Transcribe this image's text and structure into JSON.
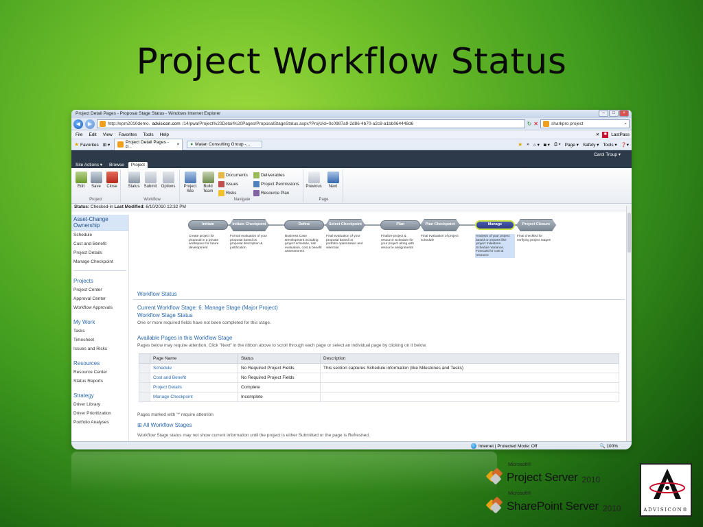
{
  "slide": {
    "title": "Project Workflow Status"
  },
  "browser": {
    "window_title": "Project Detail Pages - Proposal Stage Status - Windows Internet Explorer",
    "url_prefix": "http://epm2010demo.",
    "url_host": "advisicon.com",
    "url_path": "/14/pwa/Project%20Detail%20Pages/ProposalStageStatus.aspx?ProjUid=0c0987a9-2d86-4b70-a2c8-a1bb064448d6",
    "search_value": "sharkpro project",
    "menu": [
      "File",
      "Edit",
      "View",
      "Favorites",
      "Tools",
      "Help"
    ],
    "lastpass_label": "LastPass",
    "favorites_label": "Favorites",
    "tabs": [
      {
        "label": "Project Detail Pages - P..."
      },
      {
        "label": "Matan Consulting Group -..."
      }
    ],
    "cmd_tools": [
      "Page ▾",
      "Safety ▾",
      "Tools ▾"
    ],
    "status_zone": "Internet | Protected Mode: Off",
    "zoom": "100%"
  },
  "sharepoint": {
    "user": "Carol Troup ▾",
    "ribbon_tabs": [
      "Site Actions ▾",
      "Browse",
      "Project"
    ],
    "ribbon": {
      "project_group": "Project",
      "workflow_group": "Workflow",
      "navigate_group": "Navigate",
      "page_group": "Page",
      "edit": "Edit",
      "save": "Save",
      "close": "Close",
      "status": "Status",
      "submit": "Submit",
      "options": "Options",
      "project_site": "Project Site",
      "build_team": "Build Team",
      "documents": "Documents",
      "issues": "Issues",
      "risks": "Risks",
      "deliverables": "Deliverables",
      "project_permissions": "Project Permissions",
      "resource_plan": "Resource Plan",
      "previous": "Previous",
      "next": "Next"
    },
    "status_line": {
      "label": "Status:",
      "value": "Checked-in",
      "modified_label": "Last Modified:",
      "modified_value": "6/10/2010 12:32 PM"
    },
    "leftnav": {
      "selected": "Asset-Change Ownership",
      "top_items": [
        "Schedule",
        "Cost and Benefit",
        "Project Details",
        "Manage Checkpoint"
      ],
      "sections": [
        {
          "head": "Projects",
          "items": [
            "Project Center",
            "Approval Center",
            "Workflow Approvals"
          ]
        },
        {
          "head": "My Work",
          "items": [
            "Tasks",
            "Timesheet",
            "Issues and Risks"
          ]
        },
        {
          "head": "Resources",
          "items": [
            "Resource Center",
            "Status Reports"
          ]
        },
        {
          "head": "Strategy",
          "items": [
            "Driver Library",
            "Driver Prioritization",
            "Portfolio Analyses"
          ]
        }
      ]
    },
    "stages": [
      {
        "name": "Initiate",
        "desc": "Create project for proposal in a private workspace for future development"
      },
      {
        "name": "Initiate Checkpoint",
        "desc": "Formal evaluation of your proposal based on proposal description & justification"
      },
      {
        "name": "Define",
        "desc": "Business Case Development including project schedule, risk evaluation, cost & benefit assessments"
      },
      {
        "name": "Select Checkpoint",
        "desc": "Final evaluation of your proposal based on portfolio optimization and selection"
      },
      {
        "name": "Plan",
        "desc": "Finalize project & resource Schedule for your project along with resource assignments"
      },
      {
        "name": "Plan Checkpoint",
        "desc": "Final evaluation of project schedule"
      },
      {
        "name": "Manage",
        "desc": "Analysis of your project based on reports like project milestone Schedule Variance, Forecast for cost & resource"
      },
      {
        "name": "Project Closure",
        "desc": "Final checklist for verifying project stages"
      }
    ],
    "workflow": {
      "section_title": "Workflow Status",
      "current_stage": "Current Workflow Stage: 6. Manage Stage (Major Project)",
      "stage_status_title": "Workflow Stage Status",
      "stage_status_text": "One or more required fields have not been completed for this stage.",
      "available_title": "Available Pages in this Workflow Stage",
      "available_text": "Pages below may require attention. Click \"Next\" in the ribbon above to scroll through each page or select an individual page by clicking on it below.",
      "table_headers": [
        "Page Name",
        "Status",
        "Description"
      ],
      "table_rows": [
        {
          "name": "Schedule",
          "status": "No Required Project Fields",
          "desc": "This section captures Schedule information (like Milestones and Tasks)"
        },
        {
          "name": "Cost and Benefit",
          "status": "No Required Project Fields",
          "desc": ""
        },
        {
          "name": "Project Details",
          "status": "Complete",
          "desc": ""
        },
        {
          "name": "Manage Checkpoint",
          "status": "Incomplete",
          "desc": ""
        }
      ],
      "marked_note": "Pages marked with '*' require attention",
      "all_stages": "All Workflow Stages",
      "footer_note": "Workflow Stage status may not show current information until the project is either Submitted or the page is Refreshed."
    }
  },
  "branding": {
    "ms_label": "Microsoft®",
    "product1": "Project Server",
    "product1_ver": "2010",
    "product2": "SharePoint Server",
    "product2_ver": "2010",
    "advisicon": "ADVISICON®"
  }
}
